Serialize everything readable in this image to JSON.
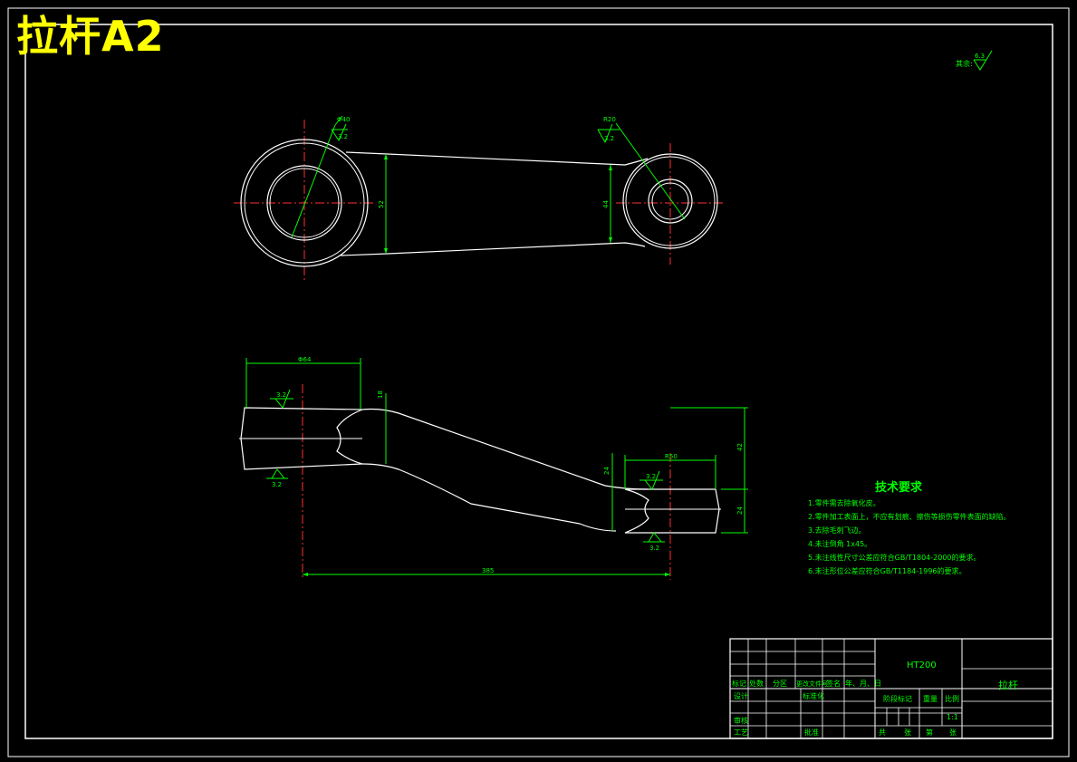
{
  "sheet_title": "拉杆A2",
  "surface_note": {
    "label": "其余:",
    "roughness": "6.3"
  },
  "top_view": {
    "dims": {
      "big_bore": "Φ40",
      "small_bore": "R20",
      "left_height": "52",
      "right_height": "44"
    },
    "roughness": {
      "big_bore": "3.2",
      "small_bore": "3.2"
    }
  },
  "front_view": {
    "dims": {
      "top_width": "Φ64",
      "thickness_left": "18",
      "height_total": "42",
      "neck": "24",
      "hub_width": "R50",
      "hub_height": "24",
      "length": "385"
    },
    "roughness": {
      "left_top": "3.2",
      "left_bottom": "3.2",
      "right_top": "3.2",
      "right_bottom": "3.2"
    }
  },
  "tech": {
    "title": "技术要求",
    "items": [
      "1.零件需去除氧化皮。",
      "2.零件加工表面上，不应有划痕、擦伤等损伤零件表面的缺陷。",
      "3.去除毛刺飞边。",
      "4.未注倒角  1x45。",
      "5.未注线性尺寸公差应符合GB/T1804-2000的要求。",
      "6.未注形位公差应符合GB/T1184-1996的要求。"
    ]
  },
  "title_block": {
    "material": "HT200",
    "part_name": "拉杆",
    "headers": [
      "标记",
      "处数",
      "分区",
      "更改文件号",
      "签名",
      "年、月、日"
    ],
    "design": "设计",
    "standardize": "标准化",
    "stage_mark": "阶段标记",
    "weight": "重量",
    "scale": "比例",
    "scale_value": "1:1",
    "review": "审核",
    "process": "工艺",
    "approve": "批准",
    "sheets_total": "共",
    "sheets_total_unit": "张",
    "sheet_no": "第",
    "sheet_no_unit": "张"
  }
}
